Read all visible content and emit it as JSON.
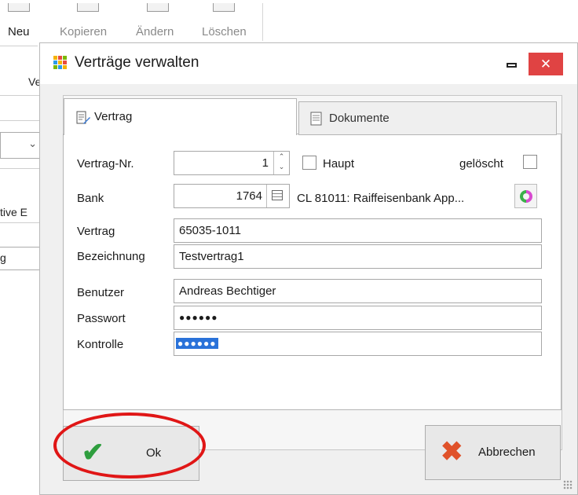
{
  "toolbar": {
    "new_label": "Neu",
    "copy_label": "Kopieren",
    "edit_label": "Ändern",
    "delete_label": "Löschen"
  },
  "background": {
    "text_ver": "Ver",
    "text_tive": "tive E",
    "text_g": "g"
  },
  "dialog": {
    "title": "Verträge verwalten",
    "close_glyph": "✕"
  },
  "tabs": [
    {
      "label": "Vertrag",
      "active": true
    },
    {
      "label": "Dokumente",
      "active": false
    }
  ],
  "form": {
    "vertrag_nr_label": "Vertrag-Nr.",
    "vertrag_nr_value": "1",
    "haupt_label": "Haupt",
    "haupt_checked": false,
    "geloescht_label": "gelöscht",
    "geloescht_checked": false,
    "bank_label": "Bank",
    "bank_value": "1764",
    "bank_name": "CL 81011: Raiffeisenbank App...",
    "vertrag_label": "Vertrag",
    "vertrag_value": "65035-1011",
    "bezeichnung_label": "Bezeichnung",
    "bezeichnung_value": "Testvertrag1",
    "benutzer_label": "Benutzer",
    "benutzer_value": "Andreas Bechtiger",
    "passwort_label": "Passwort",
    "passwort_value": "●●●●●●",
    "kontrolle_label": "Kontrolle",
    "kontrolle_value": "●●●●●●"
  },
  "buttons": {
    "ok_label": "Ok",
    "cancel_label": "Abbrechen"
  },
  "colors": {
    "close_button": "#e04343",
    "annotation_circle": "#e01616",
    "ok_check": "#2e9e3e",
    "cancel_x": "#e0522a",
    "selection": "#2a72d9"
  }
}
